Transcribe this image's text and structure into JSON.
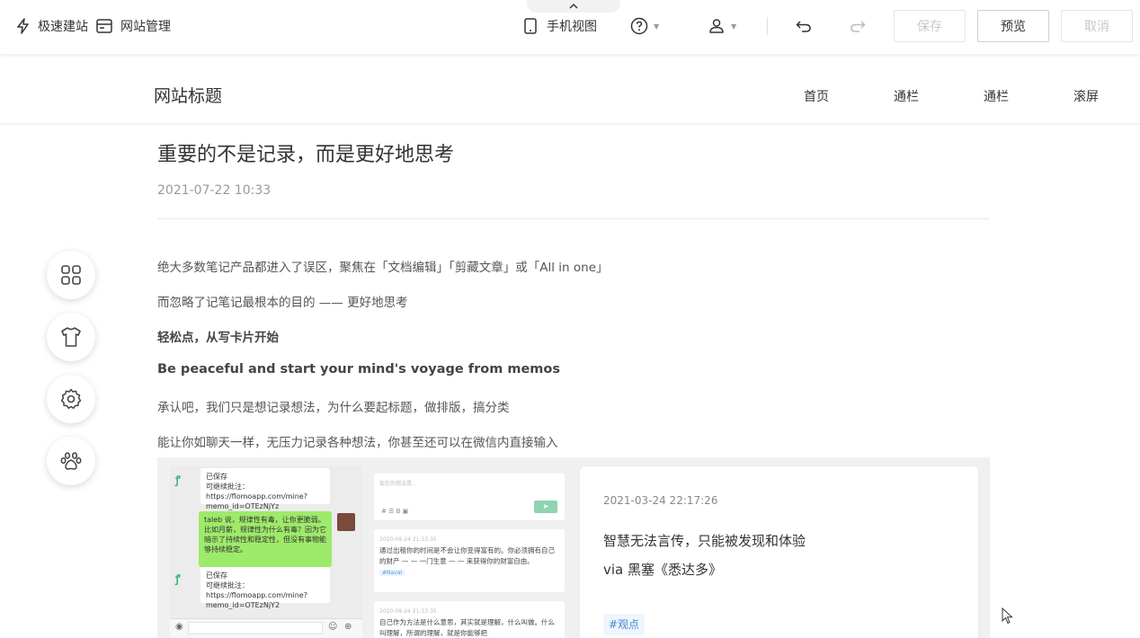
{
  "toolbar": {
    "quick_build": "极速建站",
    "site_manage": "网站管理",
    "mobile_view": "手机视图",
    "save": "保存",
    "preview": "预览",
    "cancel": "取消"
  },
  "site": {
    "title": "网站标题",
    "nav": [
      "首页",
      "通栏",
      "通栏",
      "滚屏"
    ]
  },
  "article": {
    "title": "重要的不是记录，而是更好地思考",
    "date": "2021-07-22 10:33",
    "paragraphs": [
      "绝大多数笔记产品都进入了误区，聚焦在「文档编辑」「剪藏文章」或「All in one」",
      "而忽略了记笔记最根本的目的 —— 更好地思考",
      "轻松点，从写卡片开始",
      "Be peaceful and start your mind's voyage from memos",
      "承认吧，我们只是想记录想法，为什么要起标题，做排版，搞分类",
      "能让你如聊天一样，无压力记录各种想法，你甚至还可以在微信内直接输入"
    ]
  },
  "screenshot": {
    "chat": {
      "saved1_title": "已保存",
      "saved1_text": "可继续批注：https://flomoapp.com/mine?memo_id=OTEzNjYz",
      "green_msg": "taleb 说，规律性有毒，让你更脆弱。比如月薪，规律性为什么有毒？因为它暗示了持续性和稳定性，但没有事物能够持续稳定。",
      "saved2_title": "已保存",
      "saved2_text": "可继续批注：https://flomoapp.com/mine?memo_id=OTEzNjY2"
    },
    "memos": {
      "input_placeholder": "现在的想法是...",
      "card1_meta": "2020-09-24 21:33:35",
      "card1_text": "通过出租你的时间是不会让你变得富有的。你必须拥有自己的财产 — — 一门生意 — — 来获得你的财富自由。",
      "card1_tag": "#Naval",
      "card2_meta": "2020-09-24 21:33:35",
      "card2_text": "自己作为方法是什么意思，其实就是理解，什么叫做。什么叫理解，所谓的理解，就是你能够把"
    },
    "detail": {
      "date": "2021-03-24 22:17:26",
      "line1": "智慧无法言传，只能被发现和体验",
      "line2": "via 黑塞《悉达多》",
      "tag": "#观点"
    }
  }
}
